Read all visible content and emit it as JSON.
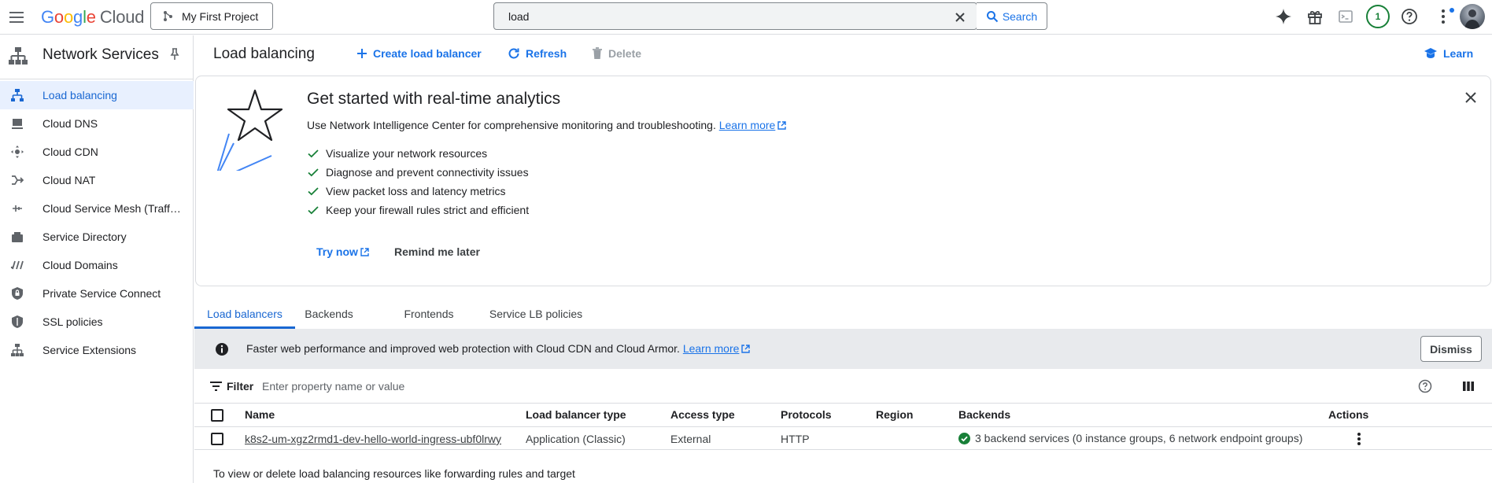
{
  "topbar": {
    "logo_google": "Google",
    "logo_cloud": "Cloud",
    "logo_colors": [
      "#4285f4",
      "#ea4335",
      "#fbbc04",
      "#4285f4",
      "#34a853",
      "#ea4335"
    ],
    "project_name": "My First Project",
    "search_value": "load",
    "search_button": "Search",
    "notification_count": "1"
  },
  "sidebar": {
    "title": "Network Services",
    "items": [
      {
        "label": "Load balancing",
        "icon": "load-balancing-icon",
        "active": true
      },
      {
        "label": "Cloud DNS",
        "icon": "dns-icon",
        "active": false
      },
      {
        "label": "Cloud CDN",
        "icon": "cdn-icon",
        "active": false
      },
      {
        "label": "Cloud NAT",
        "icon": "nat-icon",
        "active": false
      },
      {
        "label": "Cloud Service Mesh (Traff…",
        "icon": "service-mesh-icon",
        "active": false
      },
      {
        "label": "Service Directory",
        "icon": "service-directory-icon",
        "active": false
      },
      {
        "label": "Cloud Domains",
        "icon": "domains-icon",
        "active": false
      },
      {
        "label": "Private Service Connect",
        "icon": "private-service-connect-icon",
        "active": false
      },
      {
        "label": "SSL policies",
        "icon": "ssl-shield-icon",
        "active": false
      },
      {
        "label": "Service Extensions",
        "icon": "service-extensions-icon",
        "active": false
      }
    ]
  },
  "header": {
    "title": "Load balancing",
    "create_label": "Create load balancer",
    "refresh_label": "Refresh",
    "delete_label": "Delete",
    "learn_label": "Learn"
  },
  "promo": {
    "title": "Get started with real-time analytics",
    "description": "Use Network Intelligence Center for comprehensive monitoring and troubleshooting.",
    "learn_more": "Learn more",
    "checklist": [
      "Visualize your network resources",
      "Diagnose and prevent connectivity issues",
      "View packet loss and latency metrics",
      "Keep your firewall rules strict and efficient"
    ],
    "try_now": "Try now",
    "remind_later": "Remind me later"
  },
  "tabs": [
    {
      "label": "Load balancers",
      "active": true
    },
    {
      "label": "Backends",
      "active": false
    },
    {
      "label": "Frontends",
      "active": false
    },
    {
      "label": "Service LB policies",
      "active": false
    }
  ],
  "banner": {
    "text": "Faster web performance and improved web protection with Cloud CDN and Cloud Armor.",
    "learn_more": "Learn more",
    "dismiss": "Dismiss"
  },
  "filter": {
    "label": "Filter",
    "placeholder": "Enter property name or value"
  },
  "table": {
    "columns": [
      "Name",
      "Load balancer type",
      "Access type",
      "Protocols",
      "Region",
      "Backends",
      "Actions"
    ],
    "rows": [
      {
        "name": "k8s2-um-xgz2rmd1-dev-hello-world-ingress-ubf0lrwy",
        "type": "Application (Classic)",
        "access": "External",
        "protocols": "HTTP",
        "region": "",
        "backends": "3 backend services (0 instance groups, 6 network endpoint groups)",
        "backend_status": "ok"
      }
    ]
  },
  "footer_note": "To view or delete load balancing resources like forwarding rules and target",
  "colors": {
    "accent": "#1a73e8",
    "active_bg": "#e8f0fe",
    "success": "#188038",
    "banner_bg": "#e8eaed"
  }
}
